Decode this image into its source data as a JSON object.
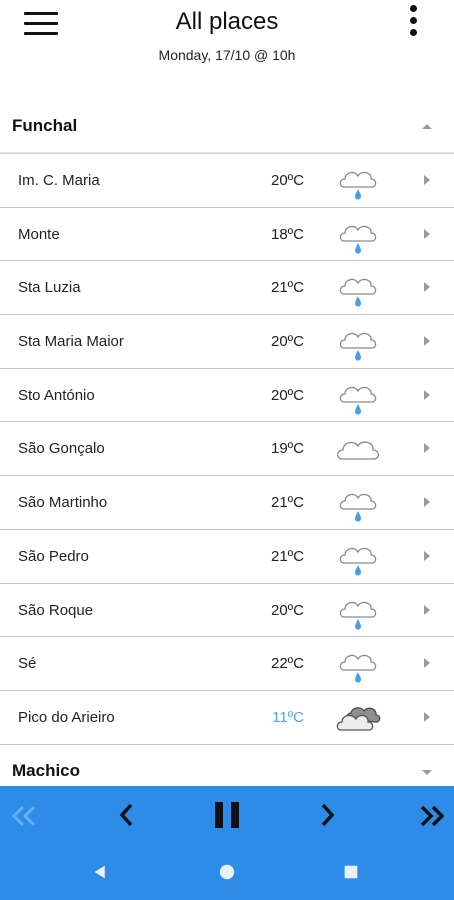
{
  "header": {
    "title": "All places",
    "subtitle": "Monday, 17/10 @ 10h"
  },
  "groups": [
    {
      "name": "Funchal",
      "expanded": true,
      "places": [
        {
          "name": "Im. C. Maria",
          "temp": "20ºC",
          "icon": "rain-cloud-icon"
        },
        {
          "name": "Monte",
          "temp": "18ºC",
          "icon": "rain-cloud-icon"
        },
        {
          "name": "Sta Luzia",
          "temp": "21ºC",
          "icon": "rain-cloud-icon"
        },
        {
          "name": "Sta Maria Maior",
          "temp": "20ºC",
          "icon": "rain-cloud-icon"
        },
        {
          "name": "Sto António",
          "temp": "20ºC",
          "icon": "rain-cloud-icon"
        },
        {
          "name": "São Gonçalo",
          "temp": "19ºC",
          "icon": "cloud-icon"
        },
        {
          "name": "São Martinho",
          "temp": "21ºC",
          "icon": "rain-cloud-icon"
        },
        {
          "name": "São Pedro",
          "temp": "21ºC",
          "icon": "rain-cloud-icon"
        },
        {
          "name": "São Roque",
          "temp": "20ºC",
          "icon": "rain-cloud-icon"
        },
        {
          "name": "Sé",
          "temp": "22ºC",
          "icon": "rain-cloud-icon"
        },
        {
          "name": "Pico do Arieiro",
          "temp": "11ºC",
          "icon": "dark-clouds-icon",
          "cold": true
        }
      ]
    },
    {
      "name": "Machico",
      "expanded": false,
      "places": []
    }
  ],
  "player": {
    "controls": [
      "first-icon",
      "previous-icon",
      "pause-icon",
      "next-icon",
      "last-icon"
    ],
    "first_disabled": true
  },
  "colors": {
    "accent": "#2d8ce8",
    "cold_temp": "#4fa3e3",
    "rain_drop": "#4a9ee6"
  }
}
